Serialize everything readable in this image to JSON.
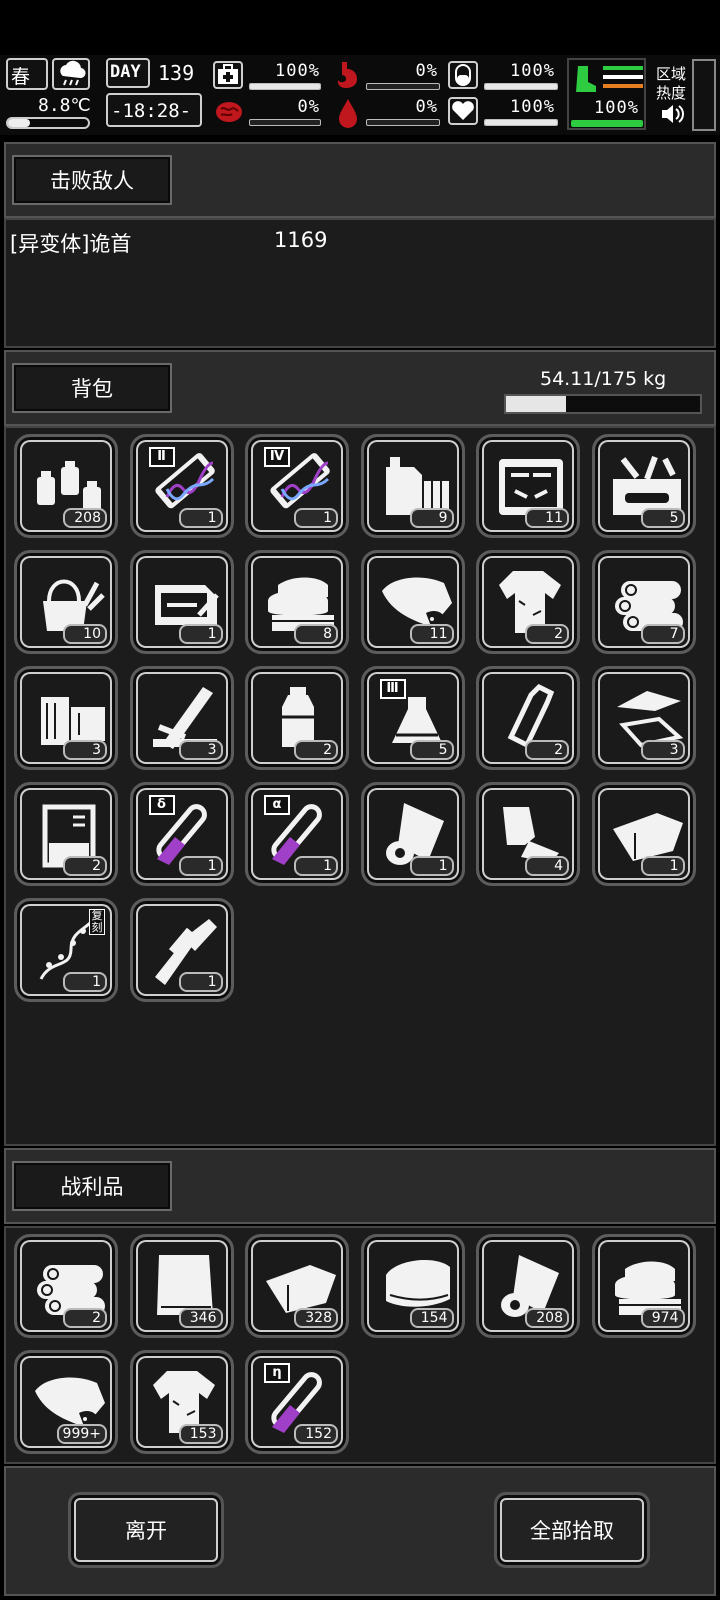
{
  "hud": {
    "season": "春",
    "temperature": "8.8℃",
    "day_label": "DAY",
    "day": "139",
    "time": "-18:28-",
    "stats": {
      "health": "100%",
      "hunger": "0%",
      "stamina": "100%",
      "infection": "0%",
      "bleeding": "0%",
      "mood": "100%",
      "leg": "100%"
    },
    "stat_levels": {
      "health": 1.0,
      "hunger": 0.0,
      "stamina": 1.0,
      "infection": 0.0,
      "bleeding": 0.0,
      "mood": 1.0,
      "leg": 1.0
    },
    "zone_heat_label": "区域\n热度"
  },
  "defeat": {
    "tab_label": "击败敌人",
    "enemy_name": "[异变体]诡首",
    "enemy_value": "1169"
  },
  "backpack": {
    "tab_label": "背包",
    "weight_text": "54.11/175 kg",
    "weight_fraction": 0.309,
    "items": [
      {
        "icon": "bottles-icon",
        "count": "208"
      },
      {
        "icon": "gene-tube-2-icon",
        "badge": "Ⅱ",
        "count": "1"
      },
      {
        "icon": "gene-tube-4-icon",
        "badge": "Ⅳ",
        "count": "1"
      },
      {
        "icon": "fuel-can-dynamite-icon",
        "count": "9"
      },
      {
        "icon": "toolbox-icon",
        "count": "11"
      },
      {
        "icon": "repair-kit-icon",
        "count": "5"
      },
      {
        "icon": "tool-bucket-icon",
        "count": "10"
      },
      {
        "icon": "tool-case-icon",
        "count": "1"
      },
      {
        "icon": "folded-cloth-icon",
        "count": "8"
      },
      {
        "icon": "raw-meat-icon",
        "count": "11"
      },
      {
        "icon": "torn-shirt-icon",
        "count": "2"
      },
      {
        "icon": "logs-icon",
        "count": "7"
      },
      {
        "icon": "wood-blocks-icon",
        "count": "3"
      },
      {
        "icon": "planks-icon",
        "count": "3"
      },
      {
        "icon": "water-bottle-icon",
        "count": "2"
      },
      {
        "icon": "flask-3-icon",
        "badge": "Ⅲ",
        "count": "5"
      },
      {
        "icon": "empty-bottle-icon",
        "count": "2"
      },
      {
        "icon": "paper-scraps-icon",
        "count": "3"
      },
      {
        "icon": "beaker-icon",
        "count": "2"
      },
      {
        "icon": "delta-test-tube-icon",
        "badge": "δ",
        "count": "1"
      },
      {
        "icon": "alpha-test-tube-icon",
        "badge": "α",
        "count": "1"
      },
      {
        "icon": "cloth-roll-icon",
        "count": "1"
      },
      {
        "icon": "rags-icon",
        "count": "4"
      },
      {
        "icon": "fabric-sheet-icon",
        "count": "1"
      },
      {
        "icon": "vine-icon",
        "tag": "复刻",
        "count": "1"
      },
      {
        "icon": "caliper-knife-icon",
        "count": "1"
      }
    ]
  },
  "loot": {
    "tab_label": "战利品",
    "items": [
      {
        "icon": "logs-icon",
        "count": "2"
      },
      {
        "icon": "cloth-sheet-icon",
        "count": "346"
      },
      {
        "icon": "fabric-sheet-icon",
        "count": "328"
      },
      {
        "icon": "leather-icon",
        "count": "154"
      },
      {
        "icon": "cloth-roll-icon",
        "count": "208"
      },
      {
        "icon": "folded-cloth-icon",
        "count": "974"
      },
      {
        "icon": "raw-meat-icon",
        "count": "999+"
      },
      {
        "icon": "torn-shirt-icon",
        "count": "153"
      },
      {
        "icon": "eta-test-tube-icon",
        "badge": "η",
        "count": "152"
      }
    ]
  },
  "actions": {
    "leave_label": "离开",
    "pickup_all_label": "全部拾取"
  }
}
